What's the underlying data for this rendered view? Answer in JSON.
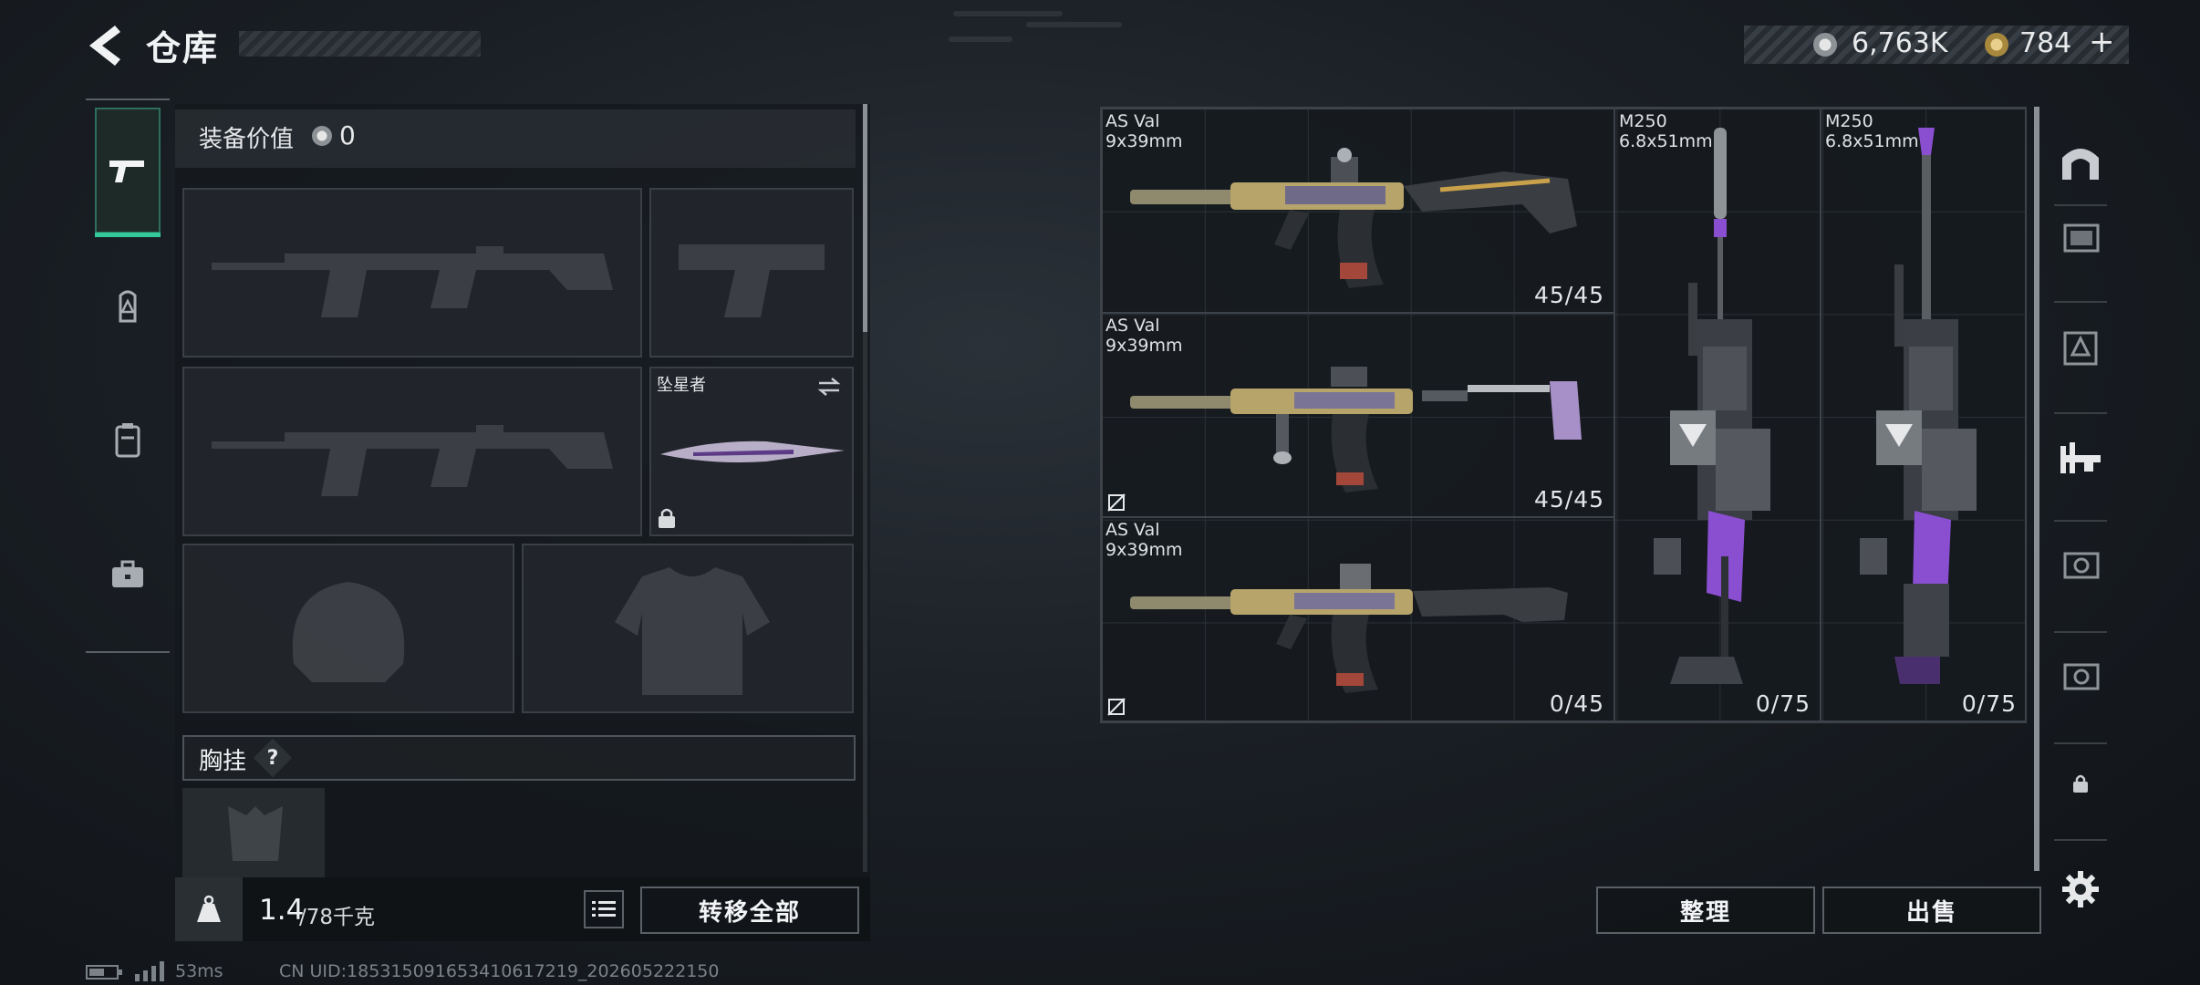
{
  "header": {
    "title": "仓库",
    "currency_a": "6,763K",
    "currency_b": "784",
    "currency_b_add": "+"
  },
  "left_panel": {
    "equip_value_label": "装备价值",
    "equip_value": "0",
    "melee_name": "坠星者",
    "chest_label": "胸挂",
    "chest_help": "?",
    "weight_value": "1.4",
    "weight_max": "/78千克",
    "transfer_all_label": "转移全部"
  },
  "grid": {
    "items": [
      {
        "name": "AS Val",
        "caliber": "9x39mm",
        "count": "45/45"
      },
      {
        "name": "AS Val",
        "caliber": "9x39mm",
        "count": "45/45"
      },
      {
        "name": "AS Val",
        "caliber": "9x39mm",
        "count": "0/45"
      },
      {
        "name": "M250",
        "caliber": "6.8x51mm",
        "count": "0/75"
      },
      {
        "name": "M250",
        "caliber": "6.8x51mm",
        "count": "0/75"
      }
    ]
  },
  "actions": {
    "sort_label": "整理",
    "sell_label": "出售"
  },
  "status": {
    "ping": "53ms",
    "uid": "CN UID:185315091653410617219_202605222150"
  },
  "colors": {
    "accent": "#34c99a",
    "gold": "#c9a14a",
    "purple": "#8a4fd1"
  }
}
